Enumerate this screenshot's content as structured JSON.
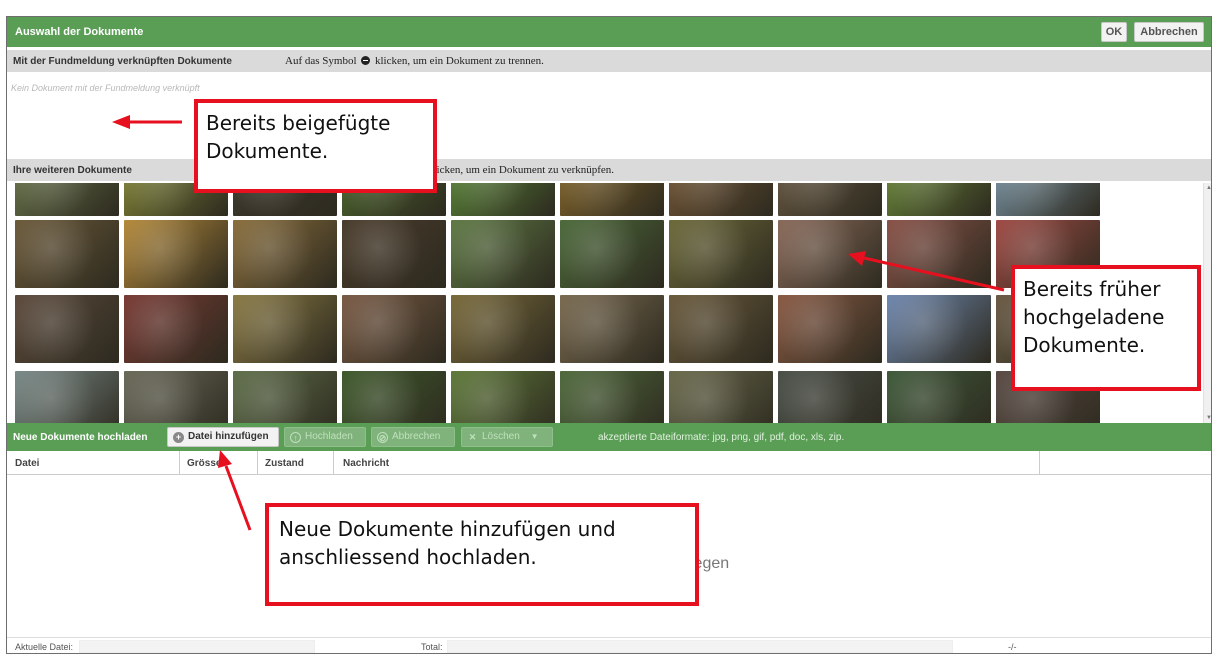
{
  "titlebar": {
    "title": "Auswahl der Dokumente",
    "ok_label": "OK",
    "cancel_label": "Abbrechen"
  },
  "linked": {
    "header": "Mit der Fundmeldung verknüpften Dokumente",
    "hint_before": "Auf das Symbol",
    "hint_after": "klicken, um ein Dokument zu trennen.",
    "empty": "Kein Dokument mit der Fundmeldung verknüpft"
  },
  "other": {
    "header": "Ihre weiteren Dokumente",
    "hint_after": "klicken, um ein Dokument zu verknüpfen."
  },
  "gallery": {
    "rows": [
      [
        "#6d7a4f",
        "#8a8f3a",
        "#3e3a2e",
        "#4f6b2f",
        "#5d8d3a",
        "#8a6a2c",
        "#7a5a38",
        "#6b5a44",
        "#6f8f3c",
        "#7f9caf"
      ],
      [
        "#6c5a3a",
        "#b58a3a",
        "#8a6e3c",
        "#4a3c2c",
        "#5f7a45",
        "#4c6a3a",
        "#6d6a3a",
        "#8a6a5a",
        "#8a5248",
        "#a04a44"
      ],
      [
        "#5c4a3c",
        "#7a3a34",
        "#8a7a44",
        "#7a5a44",
        "#7a6a3a",
        "#7a6a50",
        "#6a5a3c",
        "#8a5a44",
        "#6f88b0",
        "#6a5a44"
      ],
      [
        "#7a8a88",
        "#6a6a5a",
        "#5f6f4a",
        "#3f5a2c",
        "#5f7a3a",
        "#4f6a3c",
        "#6a6a4c",
        "#4a5048",
        "#3f5a3a",
        "#5a4a44"
      ]
    ],
    "scroll_up": "▲",
    "scroll_down": "▼"
  },
  "upload": {
    "header": "Neue Dokumente hochladen",
    "add_label": "Datei hinzufügen",
    "upload_label": "Hochladen",
    "cancel_label": "Abbrechen",
    "delete_label": "Löschen",
    "formats": "akzeptierte Dateiformate: jpg, png, gif, pdf, doc, xls, zip."
  },
  "table": {
    "columns": [
      "Datei",
      "Grösse",
      "Zustand",
      "Nachricht"
    ],
    "dropzone_text": "legen"
  },
  "status": {
    "current_label": "Aktuelle Datei:",
    "total_label": "Total:",
    "value": "-/-"
  },
  "callouts": {
    "attached": "Bereits beigefügte Dokumente.",
    "uploaded": "Bereits früher hochgeladene Dokumente.",
    "new": "Neue Dokumente hinzufügen und anschliessend hochladen."
  },
  "colors": {
    "green": "#5a9e56",
    "callout_red": "#e6101f",
    "section_gray": "#dadada"
  }
}
